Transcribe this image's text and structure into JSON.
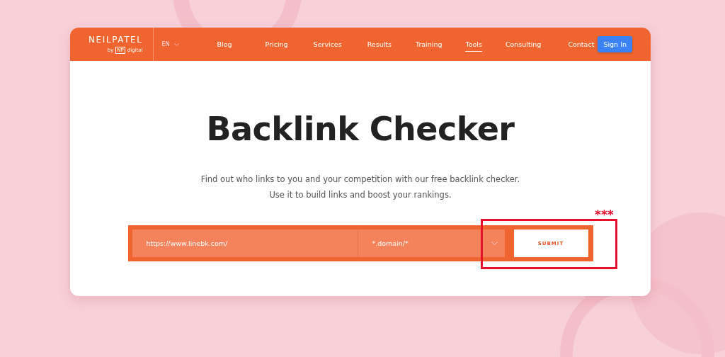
{
  "header": {
    "logo": "NEILPATEL",
    "logo_byline": "by",
    "logo_badge": "NP",
    "logo_badge_text": "digital",
    "language": "EN",
    "nav": [
      {
        "label": "Blog",
        "selected": false
      },
      {
        "label": "Pricing",
        "selected": false
      },
      {
        "label": "Services",
        "selected": false
      },
      {
        "label": "Results",
        "selected": false
      },
      {
        "label": "Training",
        "selected": false
      },
      {
        "label": "Tools",
        "selected": true
      },
      {
        "label": "Consulting",
        "selected": false
      },
      {
        "label": "Contact",
        "selected": false
      }
    ],
    "sign_in": "Sign In"
  },
  "hero": {
    "title": "Backlink Checker",
    "subtitle_lines": [
      "Find out who links to you and your competition with our free backlink checker.",
      "Use it to build links and boost your rankings."
    ]
  },
  "form": {
    "url_value": "https://www.linebk.com/",
    "scope_value": "*.domain/*",
    "submit": "SUBMIT"
  },
  "annotation": {
    "mark": "***"
  }
}
